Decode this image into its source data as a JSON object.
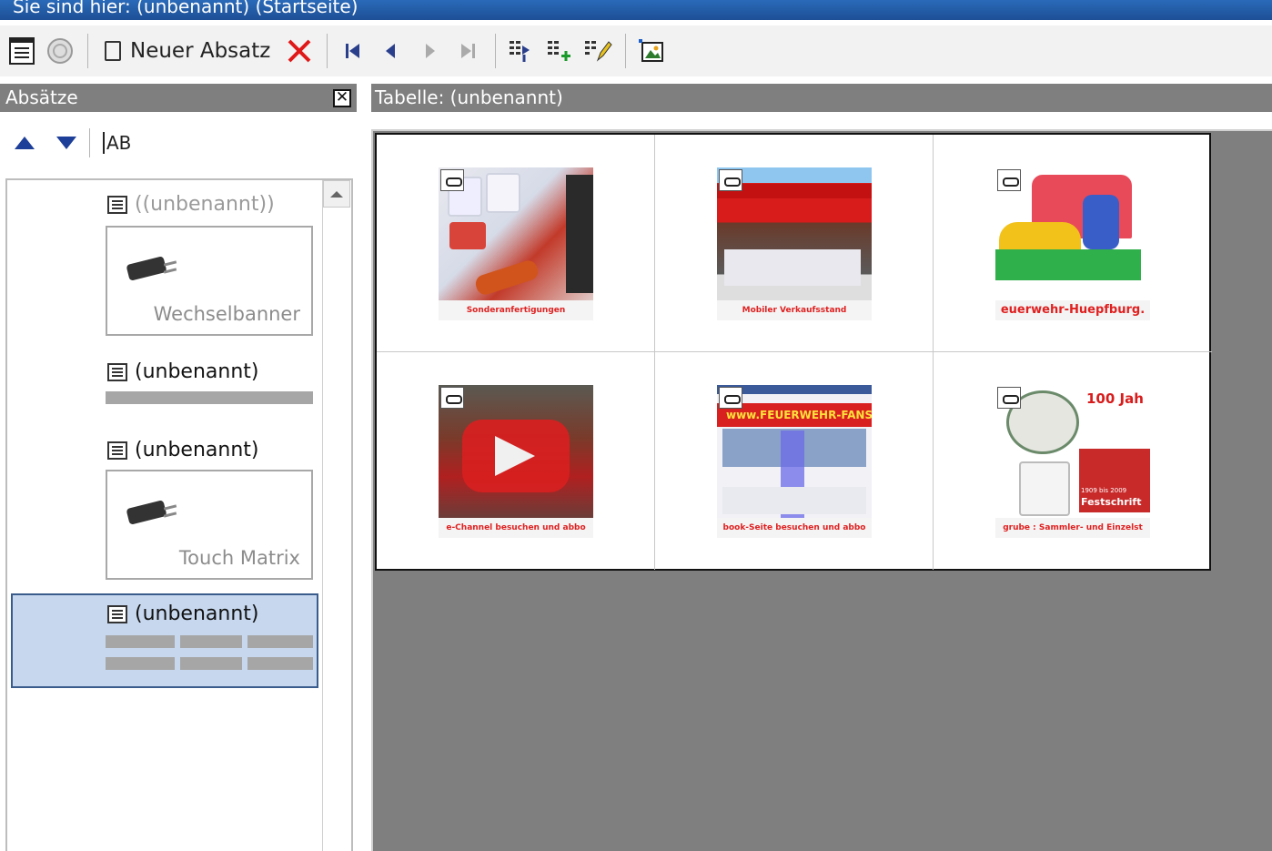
{
  "title_bar": {
    "text": "Sie sind hier: (unbenannt) (Startseite)"
  },
  "toolbar": {
    "new_paragraph_label": "Neuer Absatz"
  },
  "left_panel": {
    "header": "Absätze",
    "tool_label": "AB",
    "paragraphs": [
      {
        "title": "((unbenannt))",
        "kind": "plugin",
        "plugin_label": "Wechselbanner"
      },
      {
        "title": "(unbenannt)",
        "kind": "text"
      },
      {
        "title": "(unbenannt)",
        "kind": "plugin",
        "plugin_label": "Touch Matrix"
      },
      {
        "title": "(unbenannt)",
        "kind": "table",
        "selected": true
      }
    ]
  },
  "right_panel": {
    "header": "Tabelle: (unbenannt)",
    "cells": [
      {
        "caption": "Sonderanfertigungen"
      },
      {
        "caption": "Mobiler Verkaufsstand"
      },
      {
        "caption": "euerwehr-Huepfburg."
      },
      {
        "caption": "e-Channel besuchen und abbo"
      },
      {
        "caption": "book-Seite besuchen und abbo"
      },
      {
        "caption": "grube : Sammler- und Einzelst"
      }
    ],
    "thumb_overlay_texts": {
      "banner_6_title": "100 Jah",
      "banner_6_years": "1909 bis 2009",
      "banner_6_sub": "Festschrift",
      "banner_5_brand": "www.FEUERWEHR-FANSH"
    }
  },
  "colors": {
    "panel_header": "#7f7f7f",
    "selection": "#c6d7ee",
    "caption_red": "#e02020",
    "titlebar": "#1d4f96"
  }
}
